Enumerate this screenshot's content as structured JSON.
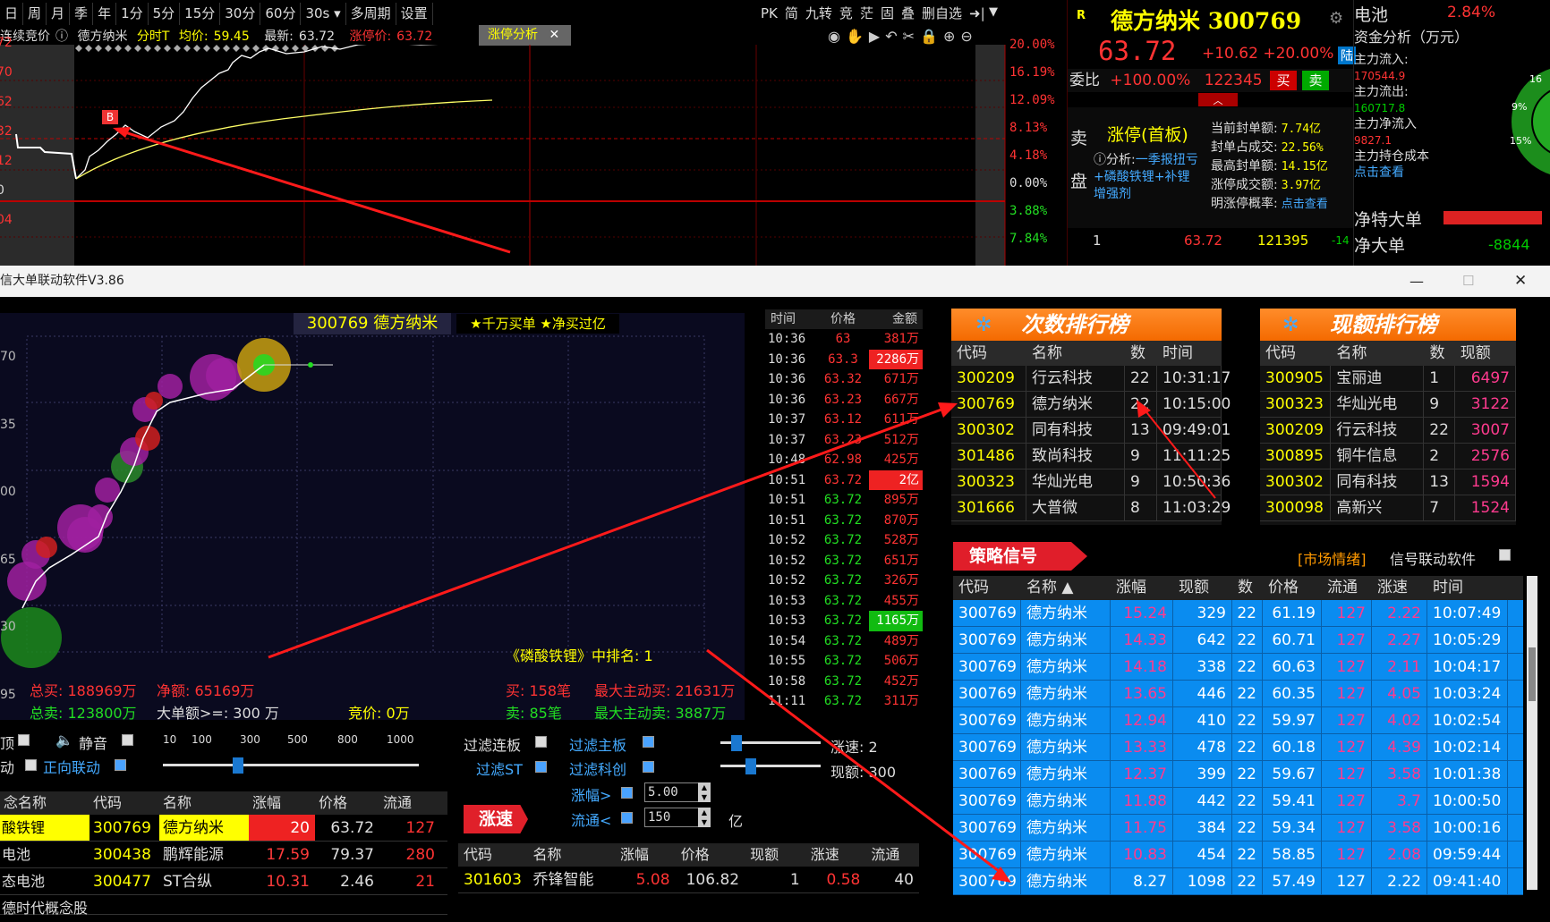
{
  "toolbar": {
    "items": [
      "日",
      "周",
      "月",
      "季",
      "年",
      "1分",
      "5分",
      "15分",
      "30分",
      "60分",
      "30s",
      "多周期",
      "设置"
    ],
    "right": [
      "PK",
      "简",
      "九转",
      "竞",
      "茫",
      "固",
      "叠",
      "删自选"
    ]
  },
  "chart_top": {
    "mode": "连续竞价",
    "name": "德方纳米",
    "type": "分时T",
    "avg_label": "均价:",
    "avg": "59.45",
    "last_label": "最新:",
    "last": "63.72",
    "limit_label": "涨停价:",
    "limit": "63.72",
    "tag": "涨停分析",
    "right_axis": [
      "20.00%",
      "16.19%",
      "12.09%",
      "8.13%",
      "4.18%",
      "0.00%",
      "3.88%",
      "7.84%"
    ],
    "left_axis": [
      "72",
      "70",
      "62",
      "32",
      "12",
      "0",
      "04"
    ],
    "marker": "B"
  },
  "quote": {
    "r": "R",
    "name": "德方纳米",
    "code": "300769",
    "price": "63.72",
    "chg": "+10.62",
    "pct": "+20.00%",
    "board": "陆",
    "wb_label": "委比",
    "wb": "+100.00%",
    "wb_vol": "122345",
    "buy": "买",
    "sell": "卖",
    "sell_label": "卖",
    "disk_label": "盘",
    "status": "涨停(首板)",
    "analysis_label": "分析:",
    "analysis": "一季报扭亏+磷酸铁锂+补锂增强剂",
    "stats": [
      [
        "当前封单额:",
        "7.74亿"
      ],
      [
        "封单占成交:",
        "22.56%"
      ],
      [
        "最高封单额:",
        "14.15亿"
      ],
      [
        "涨停成交额:",
        "3.97亿"
      ],
      [
        "明涨停概率:",
        "点击查看"
      ]
    ],
    "book_row": [
      "1",
      "63.72",
      "121395",
      "-14"
    ]
  },
  "fund": {
    "title": "电池",
    "pct": "2.84%",
    "sub": "资金分析（万元）",
    "in_label": "主力流入:",
    "in": "170544.9",
    "out_label": "主力流出:",
    "out": "160717.8",
    "net_label": "主力净流入",
    "net": "9827.1",
    "cost_label": "主力持仓成本",
    "cost": "点击查看",
    "big1": "净特大单",
    "big2": "净大单",
    "big2_val": "-8844",
    "pie": [
      "16",
      "9%",
      "15%"
    ]
  },
  "window": {
    "title": "信大单联动软件V3.86",
    "min": "—",
    "max": "☐",
    "close": "✕"
  },
  "chart2": {
    "title": "300769 德方纳米",
    "badge": "★千万买单 ★净买过亿",
    "yaxis": [
      "70",
      "35",
      "00",
      "65",
      "30",
      "95"
    ],
    "rank_note": "《磷酸铁锂》中排名: 1",
    "total_buy": "总买: 188969万",
    "net": "净额: 65169万",
    "buy_cnt": "买: 158笔",
    "max_buy": "最大主动买: 21631万",
    "total_sell": "总卖: 123800万",
    "big_thr": "大单额>=: 300 万",
    "bid": "竞价: 0万",
    "sell_cnt": "卖: 85笔",
    "max_sell": "最大主动卖: 3887万"
  },
  "ticks": {
    "headers": [
      "时间",
      "价格",
      "金额"
    ],
    "rows": [
      [
        "10:36",
        "63",
        "381万",
        "r",
        ""
      ],
      [
        "10:36",
        "63.3",
        "2286万",
        "r",
        "red"
      ],
      [
        "10:36",
        "63.32",
        "671万",
        "r",
        ""
      ],
      [
        "10:36",
        "63.23",
        "667万",
        "r",
        ""
      ],
      [
        "10:37",
        "63.12",
        "611万",
        "r",
        ""
      ],
      [
        "10:37",
        "63.23",
        "512万",
        "r",
        ""
      ],
      [
        "10:48",
        "62.98",
        "425万",
        "r",
        ""
      ],
      [
        "10:51",
        "63.72",
        "2亿",
        "r",
        "red"
      ],
      [
        "10:51",
        "63.72",
        "895万",
        "g",
        ""
      ],
      [
        "10:51",
        "63.72",
        "870万",
        "g",
        ""
      ],
      [
        "10:52",
        "63.72",
        "528万",
        "g",
        ""
      ],
      [
        "10:52",
        "63.72",
        "651万",
        "g",
        ""
      ],
      [
        "10:52",
        "63.72",
        "326万",
        "g",
        ""
      ],
      [
        "10:53",
        "63.72",
        "455万",
        "g",
        ""
      ],
      [
        "10:53",
        "63.72",
        "1165万",
        "g",
        "grn"
      ],
      [
        "10:54",
        "63.72",
        "489万",
        "g",
        ""
      ],
      [
        "10:55",
        "63.72",
        "506万",
        "g",
        ""
      ],
      [
        "10:58",
        "63.72",
        "452万",
        "g",
        ""
      ],
      [
        "11:11",
        "63.72",
        "311万",
        "g",
        ""
      ]
    ]
  },
  "rank1": {
    "title": "次数排行榜",
    "cols": [
      "代码",
      "名称",
      "数",
      "时间"
    ],
    "rows": [
      [
        "300209",
        "行云科技",
        "22",
        "10:31:17"
      ],
      [
        "300769",
        "德方纳米",
        "22",
        "10:15:00"
      ],
      [
        "300302",
        "同有科技",
        "13",
        "09:49:01"
      ],
      [
        "301486",
        "致尚科技",
        "9",
        "11:11:25"
      ],
      [
        "300323",
        "华灿光电",
        "9",
        "10:50:36"
      ],
      [
        "301666",
        "大普微",
        "8",
        "11:03:29"
      ]
    ]
  },
  "rank2": {
    "title": "现额排行榜",
    "cols": [
      "代码",
      "名称",
      "数",
      "现额"
    ],
    "rows": [
      [
        "300905",
        "宝丽迪",
        "1",
        "6497"
      ],
      [
        "300323",
        "华灿光电",
        "9",
        "3122"
      ],
      [
        "300209",
        "行云科技",
        "22",
        "3007"
      ],
      [
        "300895",
        "铜牛信息",
        "2",
        "2576"
      ],
      [
        "300302",
        "同有科技",
        "13",
        "1594"
      ],
      [
        "300098",
        "高新兴",
        "7",
        "1524"
      ]
    ]
  },
  "strategy": {
    "title": "策略信号",
    "market": "[市场情绪]",
    "link": "信号联动软件",
    "cols": [
      "代码",
      "名称",
      "涨幅",
      "现额",
      "数",
      "价格",
      "流通",
      "涨速",
      "时间"
    ],
    "rows": [
      [
        "300769",
        "德方纳米",
        "15.24",
        "329",
        "22",
        "61.19",
        "127",
        "2.22",
        "10:07:49"
      ],
      [
        "300769",
        "德方纳米",
        "14.33",
        "642",
        "22",
        "60.71",
        "127",
        "2.27",
        "10:05:29"
      ],
      [
        "300769",
        "德方纳米",
        "14.18",
        "338",
        "22",
        "60.63",
        "127",
        "2.11",
        "10:04:17"
      ],
      [
        "300769",
        "德方纳米",
        "13.65",
        "446",
        "22",
        "60.35",
        "127",
        "4.05",
        "10:03:24"
      ],
      [
        "300769",
        "德方纳米",
        "12.94",
        "410",
        "22",
        "59.97",
        "127",
        "4.02",
        "10:02:54"
      ],
      [
        "300769",
        "德方纳米",
        "13.33",
        "478",
        "22",
        "60.18",
        "127",
        "4.39",
        "10:02:14"
      ],
      [
        "300769",
        "德方纳米",
        "12.37",
        "399",
        "22",
        "59.67",
        "127",
        "3.58",
        "10:01:38"
      ],
      [
        "300769",
        "德方纳米",
        "11.88",
        "442",
        "22",
        "59.41",
        "127",
        "3.7",
        "10:00:50"
      ],
      [
        "300769",
        "德方纳米",
        "11.75",
        "384",
        "22",
        "59.34",
        "127",
        "3.58",
        "10:00:16"
      ],
      [
        "300769",
        "德方纳米",
        "10.83",
        "454",
        "22",
        "58.85",
        "127",
        "2.08",
        "09:59:44"
      ],
      [
        "300769",
        "德方纳米",
        "8.27",
        "1098",
        "22",
        "57.49",
        "127",
        "2.22",
        "09:41:40"
      ]
    ]
  },
  "controls": {
    "quiet": "静音",
    "mode_a": "顶",
    "mode_b": "动",
    "forward": "正向联动",
    "scale": [
      "10",
      "100",
      "300",
      "500",
      "800",
      "1000"
    ],
    "f1": "过滤连板",
    "f2": "过滤ST",
    "f3": "过滤主板",
    "f4": "过滤科创",
    "zf_label": "涨幅>",
    "zf": "5.00",
    "lt_label": "流通<",
    "lt": "150",
    "unit": "亿",
    "speed_label": "涨速:",
    "speed": "2",
    "amount_label": "现额:",
    "amount": "300",
    "btn": "涨速"
  },
  "concept": {
    "cols": [
      "念名称",
      "代码",
      "名称",
      "涨幅",
      "价格",
      "流通"
    ],
    "left": [
      "酸铁锂",
      "电池",
      "态电池",
      "德时代概念股"
    ],
    "rows": [
      [
        "300769",
        "德方纳米",
        "20",
        "63.72",
        "127"
      ],
      [
        "300438",
        "鹏辉能源",
        "17.59",
        "79.37",
        "280"
      ],
      [
        "300477",
        "ST合纵",
        "10.31",
        "2.46",
        "21"
      ]
    ]
  },
  "speedtbl": {
    "cols": [
      "代码",
      "名称",
      "涨幅",
      "价格",
      "现额",
      "涨速",
      "流通"
    ],
    "rows": [
      [
        "301603",
        "乔锋智能",
        "5.08",
        "106.82",
        "1",
        "0.58",
        "40"
      ]
    ]
  },
  "colors": {
    "up": "#ff3333",
    "down": "#22dd22",
    "accent": "#ff8c2a",
    "select": "#0a8cf0"
  }
}
